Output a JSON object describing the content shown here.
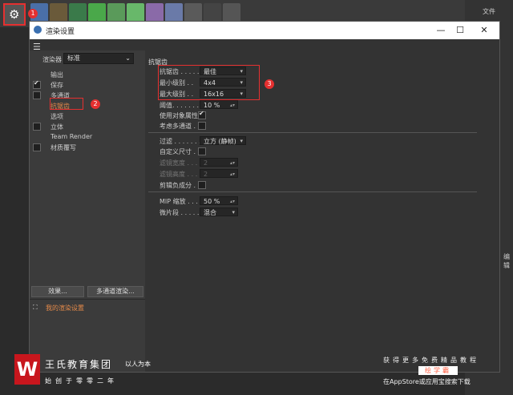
{
  "menubar": {
    "file": "文件",
    "right_label": "编辑"
  },
  "badges": {
    "b1": "1",
    "b2": "2",
    "b3": "3"
  },
  "dialog": {
    "title": "渲染设置",
    "renderer_label": "渲染器",
    "renderer_value": "标准",
    "tree": [
      "输出",
      "保存",
      "多通道",
      "抗锯齿",
      "选项",
      "立体",
      "Team Render",
      "材质覆写"
    ],
    "buttons": {
      "effects": "效果...",
      "multipass": "多通道渲染..."
    },
    "my_setting": "我的渲染设置"
  },
  "antialias": {
    "section_title": "抗锯齿",
    "rows": [
      {
        "label": "抗锯齿 . . . . .",
        "value": "最佳"
      },
      {
        "label": "最小级别 . .",
        "value": "4x4"
      },
      {
        "label": "最大级别 . .",
        "value": "16x16"
      }
    ],
    "threshold_label": "阈值. . . . . . . .",
    "threshold_value": "10 %",
    "use_object_props": "使用对象属性",
    "consider_multipass": "考虑多通道 . .",
    "filter_label": "过滤 . . . . . . .",
    "filter_value": "立方 (静帧)",
    "custom_size": "自定义尺寸 . .",
    "filter_width": "滤镜宽度 . . .",
    "filter_width_value": "2",
    "filter_height": "滤镜高度 . . .",
    "filter_height_value": "2",
    "clip_negative": "剪辑负成分 . .",
    "mip_label": "MIP 缩放 . . . .",
    "mip_value": "50 %",
    "micro_label": "微片段 . . . . .",
    "micro_value": "混合"
  },
  "watermark": {
    "logo": "W",
    "name": "王氏教育集团",
    "slogan": "以人为本",
    "founded": "始创于零零二年",
    "r1": "获得更多免费精品教程",
    "r2": "绘学霸",
    "r3": "在AppStore或应用宝搜索下载"
  },
  "colors": {
    "accent": "#e53030",
    "highlight": "#e58a4a"
  }
}
